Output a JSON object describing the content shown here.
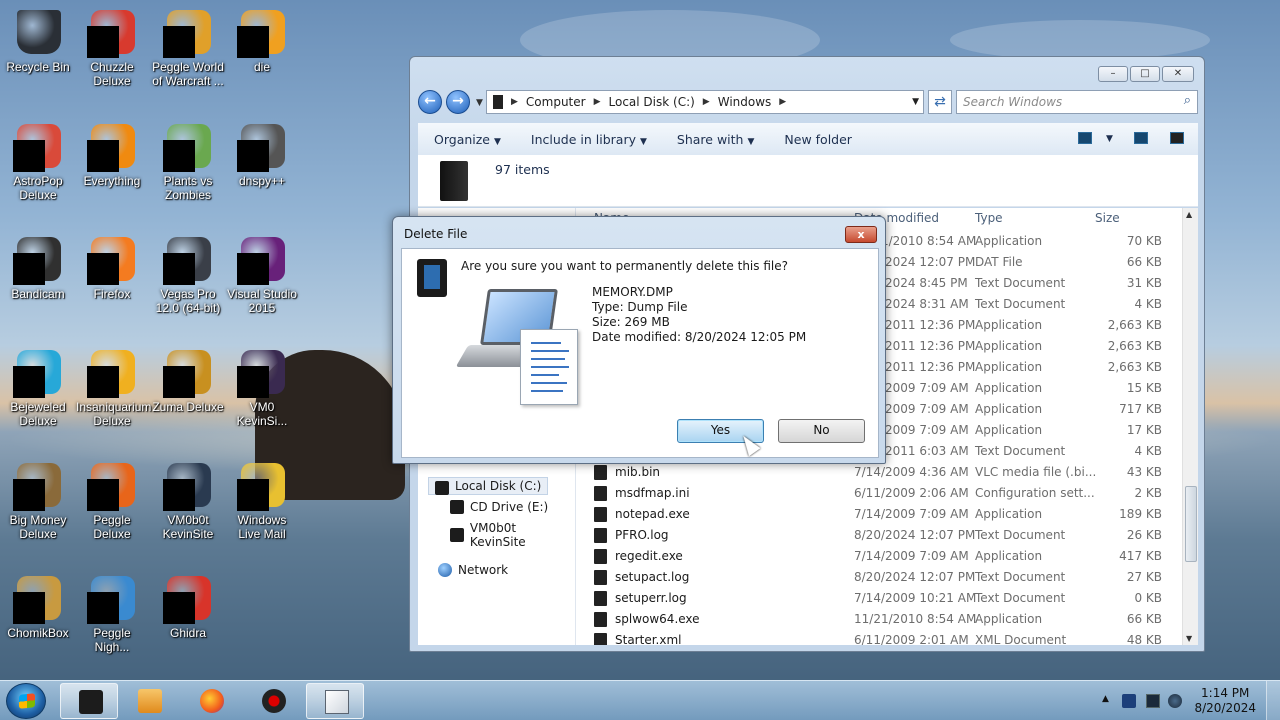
{
  "desktop": {
    "icons": [
      {
        "label": "Recycle Bin",
        "icon": "recycle-bin-icon",
        "color": "#2a2f36"
      },
      {
        "label": "Chuzzle Deluxe",
        "icon": "chuzzle-icon",
        "color": "#d83a2e"
      },
      {
        "label": "Peggle World of Warcraft ...",
        "icon": "peggle-wow-icon",
        "color": "#e0a02a"
      },
      {
        "label": "die",
        "icon": "die-icon",
        "color": "#f0a020"
      },
      {
        "label": "AstroPop Deluxe",
        "icon": "astropop-icon",
        "color": "#d94a3a"
      },
      {
        "label": "Everything",
        "icon": "everything-icon",
        "color": "#f08a10"
      },
      {
        "label": "Plants vs Zombies",
        "icon": "plants-vs-zombies-icon",
        "color": "#6aa84f"
      },
      {
        "label": "dnspy++",
        "icon": "dnspy-icon",
        "color": "#555555"
      },
      {
        "label": "Bandicam",
        "icon": "bandicam-icon",
        "color": "#303030"
      },
      {
        "label": "Firefox",
        "icon": "firefox-icon",
        "color": "#f47b20"
      },
      {
        "label": "Vegas Pro 12.0 (64-bit)",
        "icon": "vegas-pro-icon",
        "color": "#3a3f48"
      },
      {
        "label": "Visual Studio 2015",
        "icon": "visual-studio-icon",
        "color": "#68217a"
      },
      {
        "label": "Bejeweled Deluxe",
        "icon": "bejeweled-icon",
        "color": "#27a8d8"
      },
      {
        "label": "Insaniquarium Deluxe",
        "icon": "insaniquarium-icon",
        "color": "#f0b020"
      },
      {
        "label": "Zuma Deluxe",
        "icon": "zuma-icon",
        "color": "#c89020"
      },
      {
        "label": "VM0 KevinSi...",
        "icon": "vm0-kevinsite-icon",
        "color": "#3a2a50"
      },
      {
        "label": "Big Money Deluxe",
        "icon": "big-money-icon",
        "color": "#8a6a3a"
      },
      {
        "label": "Peggle Deluxe",
        "icon": "peggle-deluxe-icon",
        "color": "#e8651a"
      },
      {
        "label": "VM0b0t KevinSite",
        "icon": "vm0b0t-kevinsite-icon",
        "color": "#2a3a50"
      },
      {
        "label": "Windows Live Mail",
        "icon": "windows-live-mail-icon",
        "color": "#e8c030"
      },
      {
        "label": "ChomikBox",
        "icon": "chomikbox-icon",
        "color": "#c89a40"
      },
      {
        "label": "Peggle Nigh...",
        "icon": "peggle-nights-icon",
        "color": "#3a8ad0"
      },
      {
        "label": "Ghidra",
        "icon": "ghidra-icon",
        "color": "#d8342a"
      }
    ]
  },
  "explorer": {
    "address": {
      "crumbs": [
        "Computer",
        "Local Disk (C:)",
        "Windows"
      ]
    },
    "search_placeholder": "Search Windows",
    "toolbar": {
      "organize": "Organize",
      "include_in_library": "Include in library",
      "share_with": "Share with",
      "new_folder": "New folder"
    },
    "item_count": "97 items",
    "columns": {
      "name": "Name",
      "date_modified": "Date modified",
      "type": "Type",
      "size": "Size"
    },
    "nav": {
      "local_disk": "Local Disk (C:)",
      "cd_drive": "CD Drive (E:)",
      "vm_share": "VM0b0t KevinSite",
      "network": "Network"
    },
    "files": [
      {
        "name": "",
        "date": "11/21/2010 8:54 AM",
        "type": "Application",
        "size": "70 KB"
      },
      {
        "name": "",
        "date": "8/20/2024 12:07 PM",
        "type": "DAT File",
        "size": "66 KB"
      },
      {
        "name": "",
        "date": "8/20/2024 8:45 PM",
        "type": "Text Document",
        "size": "31 KB"
      },
      {
        "name": "",
        "date": "8/20/2024 8:31 AM",
        "type": "Text Document",
        "size": "4 KB"
      },
      {
        "name": "",
        "date": "6/11/2011 12:36 PM",
        "type": "Application",
        "size": "2,663 KB"
      },
      {
        "name": "",
        "date": "6/11/2011 12:36 PM",
        "type": "Application",
        "size": "2,663 KB"
      },
      {
        "name": "",
        "date": "6/11/2011 12:36 PM",
        "type": "Application",
        "size": "2,663 KB"
      },
      {
        "name": "",
        "date": "7/14/2009 7:09 AM",
        "type": "Application",
        "size": "15 KB"
      },
      {
        "name": "",
        "date": "7/14/2009 7:09 AM",
        "type": "Application",
        "size": "717 KB"
      },
      {
        "name": "",
        "date": "7/14/2009 7:09 AM",
        "type": "Application",
        "size": "17 KB"
      },
      {
        "name": "",
        "date": "6/10/2011 6:03 AM",
        "type": "Text Document",
        "size": "4 KB"
      },
      {
        "name": "mib.bin",
        "date": "7/14/2009 4:36 AM",
        "type": "VLC media file (.bi...",
        "size": "43 KB"
      },
      {
        "name": "msdfmap.ini",
        "date": "6/11/2009 2:06 AM",
        "type": "Configuration sett...",
        "size": "2 KB"
      },
      {
        "name": "notepad.exe",
        "date": "7/14/2009 7:09 AM",
        "type": "Application",
        "size": "189 KB"
      },
      {
        "name": "PFRO.log",
        "date": "8/20/2024 12:07 PM",
        "type": "Text Document",
        "size": "26 KB"
      },
      {
        "name": "regedit.exe",
        "date": "7/14/2009 7:09 AM",
        "type": "Application",
        "size": "417 KB"
      },
      {
        "name": "setupact.log",
        "date": "8/20/2024 12:07 PM",
        "type": "Text Document",
        "size": "27 KB"
      },
      {
        "name": "setuperr.log",
        "date": "7/14/2009 10:21 AM",
        "type": "Text Document",
        "size": "0 KB"
      },
      {
        "name": "splwow64.exe",
        "date": "11/21/2010 8:54 AM",
        "type": "Application",
        "size": "66 KB"
      },
      {
        "name": "Starter.xml",
        "date": "6/11/2009 2:01 AM",
        "type": "XML Document",
        "size": "48 KB"
      }
    ]
  },
  "dialog": {
    "title": "Delete File",
    "question": "Are you sure you want to permanently delete this file?",
    "file_name": "MEMORY.DMP",
    "file_type": "Type: Dump File",
    "file_size": "Size: 269 MB",
    "file_date": "Date modified: 8/20/2024 12:05 PM",
    "yes": "Yes",
    "no": "No",
    "close": "x"
  },
  "taskbar": {
    "time": "1:14 PM",
    "date": "8/20/2024"
  },
  "colors": {
    "accent": "#3c7fb1",
    "close_red": "#c64a2f"
  }
}
